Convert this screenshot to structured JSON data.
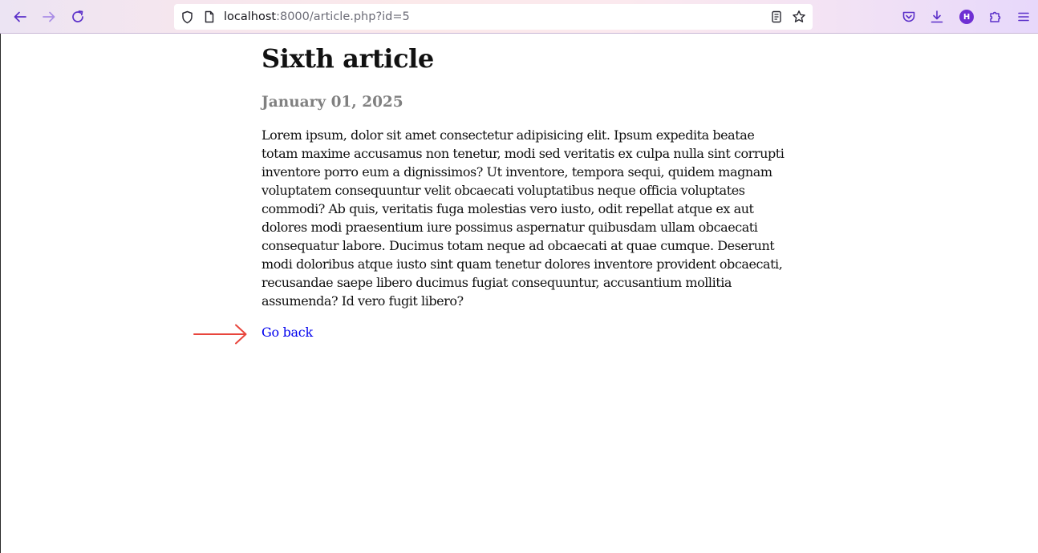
{
  "browser": {
    "url_host": "localhost",
    "url_rest": ":8000/article.php?id=5",
    "account_initial": "H",
    "icons": {
      "back": "back-arrow-icon",
      "forward": "forward-arrow-icon",
      "reload": "reload-icon",
      "tracking": "shield-icon",
      "page_info": "page-icon",
      "reader": "reader-view-icon",
      "bookmark": "star-icon",
      "pocket": "pocket-icon",
      "downloads": "download-icon",
      "extensions": "puzzle-icon",
      "menu": "hamburger-menu-icon"
    },
    "accent_color": "#6e2fd3"
  },
  "article": {
    "title": "Sixth article",
    "date": "January 01, 2025",
    "body": "Lorem ipsum, dolor sit amet consectetur adipisicing elit. Ipsum expedita beatae totam maxime accusamus non tenetur, modi sed veritatis ex culpa nulla sint corrupti inventore porro eum a dignissimos? Ut inventore, tempora sequi, quidem magnam voluptatem consequuntur velit obcaecati voluptatibus neque officia voluptates commodi? Ab quis, veritatis fuga molestias vero iusto, odit repellat atque ex aut dolores modi praesentium iure possimus aspernatur quibusdam ullam obcaecati consequatur labore. Ducimus totam neque ad obcaecati at quae cumque. Deserunt modi doloribus atque iusto sint quam tenetur dolores inventore provident obcaecati, recusandae saepe libero ducimus fugiat consequuntur, accusantium mollitia assumenda? Id vero fugit libero?",
    "back_link": "Go back"
  },
  "annotation": {
    "arrow_color": "#e8453c"
  }
}
